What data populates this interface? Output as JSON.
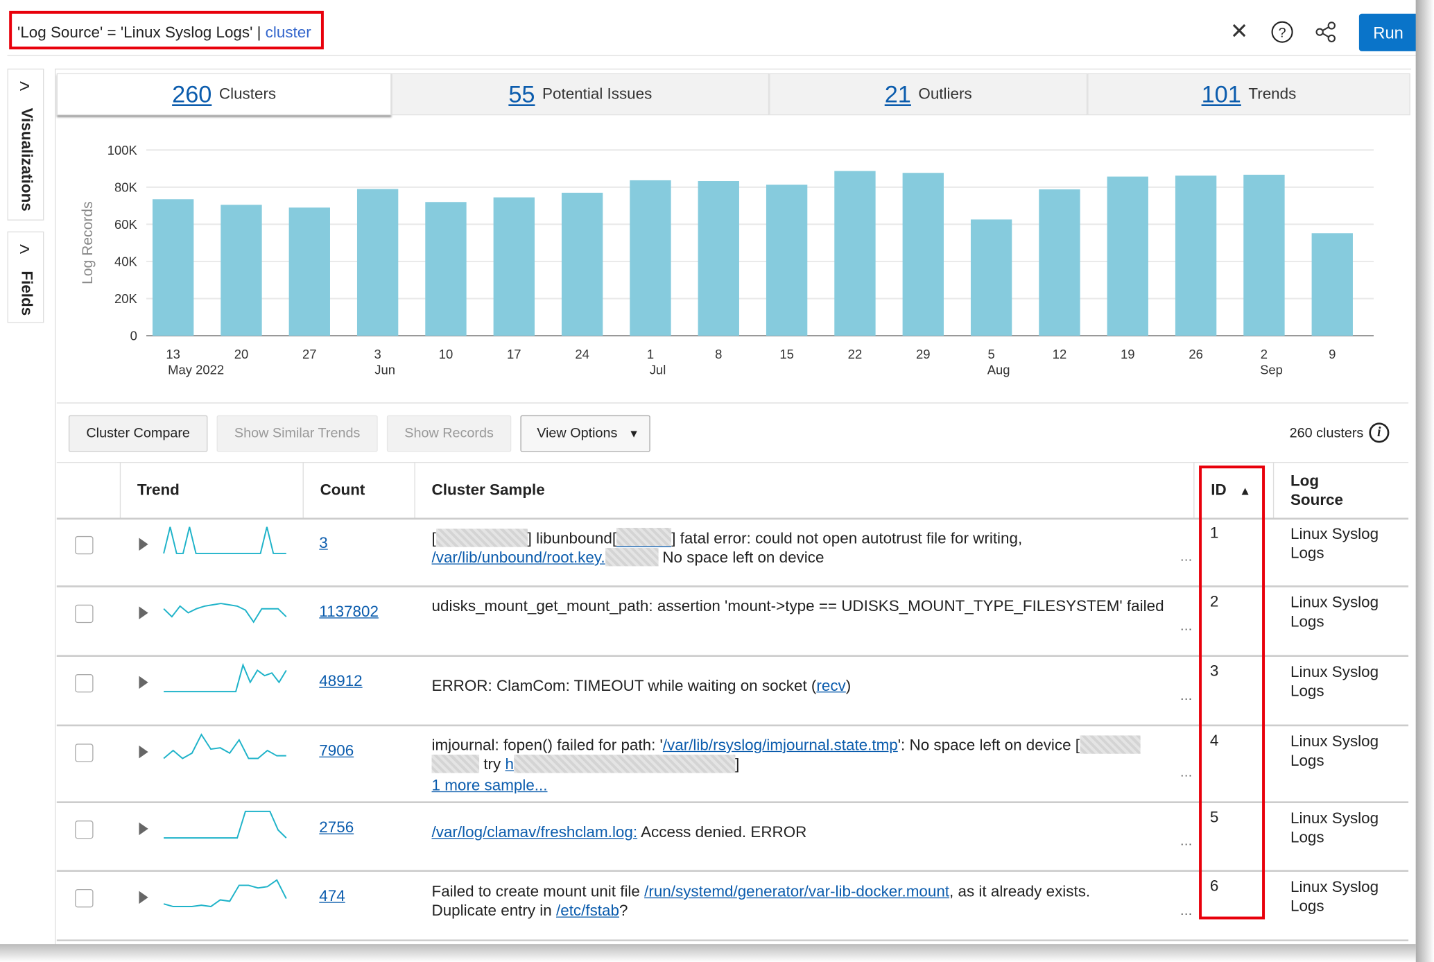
{
  "query": {
    "text": "'Log Source' = 'Linux Syslog Logs' | ",
    "command": "cluster"
  },
  "toolbar": {
    "close_icon": "close-icon",
    "help_icon": "help-icon",
    "share_icon": "share-icon",
    "run_label": "Run",
    "accent": "#0a74c9"
  },
  "sidebar": {
    "items": [
      {
        "label": "Visualizations"
      },
      {
        "label": "Fields"
      }
    ]
  },
  "tabs": [
    {
      "count": "260",
      "label": "Clusters",
      "active": true
    },
    {
      "count": "55",
      "label": "Potential Issues"
    },
    {
      "count": "21",
      "label": "Outliers"
    },
    {
      "count": "101",
      "label": "Trends"
    }
  ],
  "chart_data": {
    "type": "bar",
    "ylabel": "Log Records",
    "xlabel": "",
    "ylim": [
      0,
      100000
    ],
    "yticks": [
      "0",
      "20K",
      "40K",
      "60K",
      "80K",
      "100K"
    ],
    "grid": true,
    "color": "#86cbdd",
    "categories": [
      {
        "day": "13",
        "month": "May 2022"
      },
      {
        "day": "20"
      },
      {
        "day": "27"
      },
      {
        "day": "3",
        "month": "Jun"
      },
      {
        "day": "10"
      },
      {
        "day": "17"
      },
      {
        "day": "24"
      },
      {
        "day": "1",
        "month": "Jul"
      },
      {
        "day": "8"
      },
      {
        "day": "15"
      },
      {
        "day": "22"
      },
      {
        "day": "29"
      },
      {
        "day": "5",
        "month": "Aug"
      },
      {
        "day": "12"
      },
      {
        "day": "19"
      },
      {
        "day": "26"
      },
      {
        "day": "2",
        "month": "Sep"
      },
      {
        "day": "9"
      }
    ],
    "values": [
      73500,
      70500,
      69000,
      79000,
      72000,
      74500,
      77000,
      83700,
      83300,
      81300,
      88700,
      87700,
      62600,
      78800,
      85700,
      86200,
      86700,
      55200
    ]
  },
  "actions": {
    "cluster_compare": "Cluster Compare",
    "show_similar_trends": "Show Similar Trends",
    "show_records": "Show Records",
    "view_options": "View Options"
  },
  "cluster_count": "260 clusters",
  "table": {
    "headers": {
      "trend": "Trend",
      "count": "Count",
      "sample": "Cluster Sample",
      "id": "ID",
      "source": "Log Source"
    },
    "sparkline_color": "#1fb3c9",
    "rows": [
      {
        "id": "1",
        "count": "3",
        "source": "Linux Syslog Logs",
        "trend": [
          0,
          1,
          0,
          0,
          1,
          0,
          0,
          0,
          0,
          0,
          0,
          0,
          0,
          0,
          0,
          0,
          1,
          0,
          0,
          0
        ],
        "sample": [
          {
            "t": "["
          },
          {
            "blur": 100
          },
          {
            "t": "] libunbound["
          },
          {
            "blur": 60,
            "link": true
          },
          {
            "t": "] fatal error: could not open autotrust file for writing, "
          },
          {
            "br": true
          },
          {
            "t": "/var/lib/unbound/root.key.",
            "link": true
          },
          {
            "blur": 58
          },
          {
            "t": " No space left on device"
          }
        ]
      },
      {
        "id": "2",
        "count": "1137802",
        "source": "Linux Syslog Logs",
        "trend": [
          0.5,
          0.2,
          0.6,
          0.35,
          0.5,
          0.6,
          0.65,
          0.7,
          0.65,
          0.6,
          0.45,
          0,
          0.5,
          0.5,
          0.5,
          0.2
        ],
        "sample": [
          {
            "t": "udisks_mount_get_mount_path: assertion 'mount->type == UDISKS_MOUNT_TYPE_FILESYSTEM' failed"
          }
        ]
      },
      {
        "id": "3",
        "count": "48912",
        "source": "Linux Syslog Logs",
        "trend": [
          0,
          0,
          0,
          0,
          0,
          0,
          0,
          0,
          0,
          0,
          0,
          1,
          0.35,
          0.8,
          0.6,
          0.7,
          0.35,
          0.8
        ],
        "sample": [
          {
            "t": "ERROR: ClamCom: TIMEOUT while waiting on socket ("
          },
          {
            "t": "recv",
            "link": true
          },
          {
            "t": ")"
          }
        ]
      },
      {
        "id": "4",
        "count": "7906",
        "source": "Linux Syslog Logs",
        "trend": [
          0.1,
          0.4,
          0.1,
          0.3,
          1,
          0.45,
          0.5,
          0.3,
          0.8,
          0.1,
          0.1,
          0.4,
          0.2,
          0.2
        ],
        "sample": [
          {
            "t": "imjournal: fopen() failed for path: '"
          },
          {
            "t": "/var/lib/rsyslog/imjournal.state.tmp",
            "link": true
          },
          {
            "t": "': No space left on device ["
          },
          {
            "blur": 66
          },
          {
            "br": true
          },
          {
            "blur": 52
          },
          {
            "t": " try "
          },
          {
            "t": "h",
            "link": true
          },
          {
            "blur": 242
          },
          {
            "t": "]"
          }
        ],
        "more": "1 more sample..."
      },
      {
        "id": "5",
        "count": "2756",
        "source": "Linux Syslog Logs",
        "trend": [
          0,
          0,
          0,
          0,
          0,
          0,
          0,
          0,
          0,
          0,
          1,
          1,
          1,
          1,
          0.3,
          0
        ],
        "sample": [
          {
            "t": "/var/log/clamav/freshclam.log:",
            "link": true
          },
          {
            "t": " Access denied. ERROR"
          }
        ]
      },
      {
        "id": "6",
        "count": "474",
        "source": "Linux Syslog Logs",
        "trend": [
          0.1,
          0,
          0,
          0,
          0.05,
          0,
          0.25,
          0.2,
          0.8,
          0.8,
          0.7,
          0.75,
          1,
          0.3
        ],
        "sample": [
          {
            "t": "Failed to create mount unit file "
          },
          {
            "t": "/run/systemd/generator/var-lib-docker.mount",
            "link": true
          },
          {
            "t": ", as it already exists. "
          },
          {
            "br": true
          },
          {
            "t": "Duplicate entry in "
          },
          {
            "t": "/etc/fstab",
            "link": true
          },
          {
            "t": "?"
          }
        ]
      }
    ]
  }
}
